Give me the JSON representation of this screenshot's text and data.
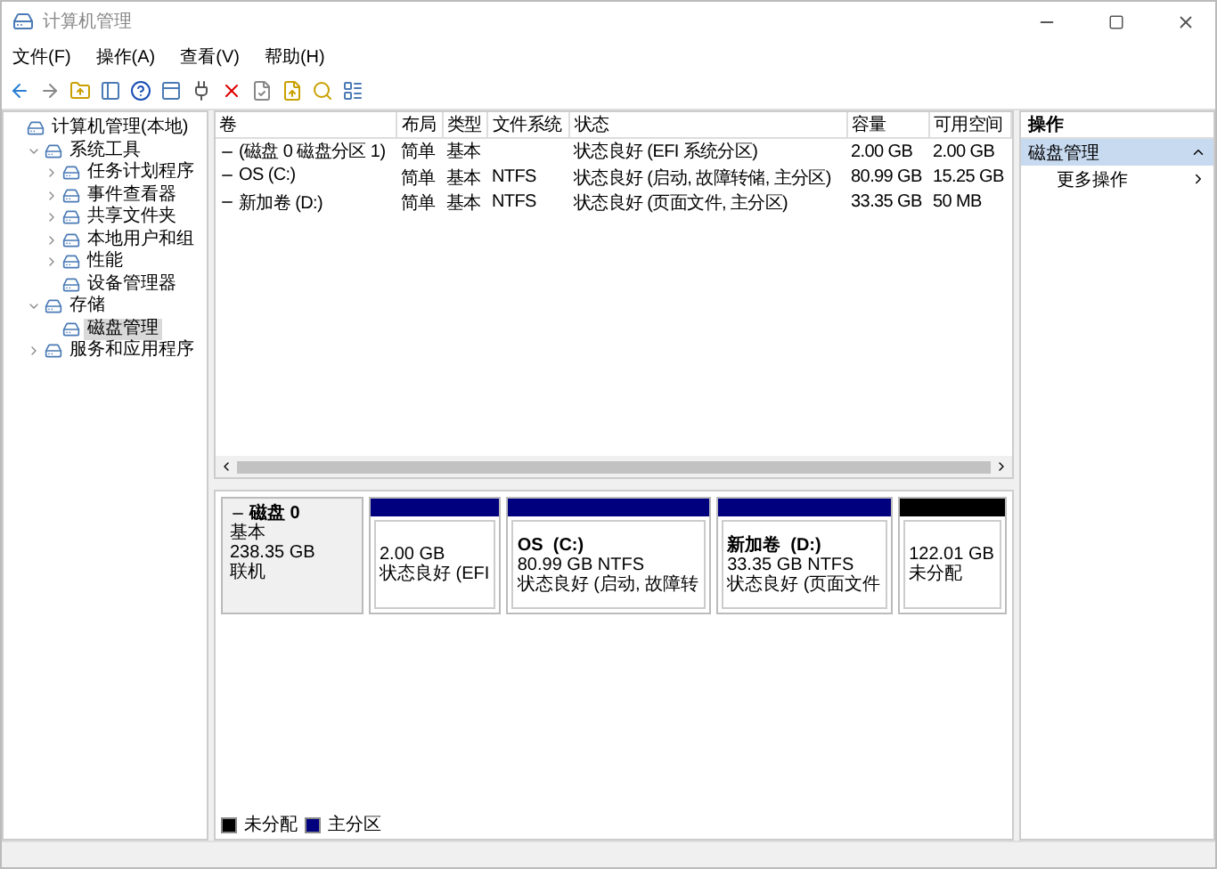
{
  "window": {
    "title": "计算机管理"
  },
  "menu": [
    "文件(F)",
    "操作(A)",
    "查看(V)",
    "帮助(H)"
  ],
  "tree": [
    {
      "label": "计算机管理(本地)",
      "selected": false,
      "children": [
        {
          "label": "系统工具",
          "expanded": true,
          "selected": false,
          "children": [
            {
              "label": "任务计划程序",
              "expanded": false,
              "selected": false
            },
            {
              "label": "事件查看器",
              "expanded": false,
              "selected": false
            },
            {
              "label": "共享文件夹",
              "expanded": false,
              "selected": false
            },
            {
              "label": "本地用户和组",
              "expanded": false,
              "selected": false
            },
            {
              "label": "性能",
              "expanded": false,
              "selected": false
            },
            {
              "label": "设备管理器",
              "selected": false
            }
          ]
        },
        {
          "label": "存储",
          "expanded": true,
          "selected": false,
          "children": [
            {
              "label": "磁盘管理",
              "selected": true
            }
          ]
        },
        {
          "label": "服务和应用程序",
          "expanded": false,
          "selected": false
        }
      ]
    }
  ],
  "volume_table": {
    "columns": [
      "卷",
      "布局",
      "类型",
      "文件系统",
      "状态",
      "容量",
      "可用空间"
    ],
    "rows": [
      [
        "(磁盘 0 磁盘分区 1)",
        "简单",
        "基本",
        "",
        "状态良好 (EFI 系统分区)",
        "2.00 GB",
        "2.00 GB"
      ],
      [
        "OS (C:)",
        "简单",
        "基本",
        "NTFS",
        "状态良好 (启动, 故障转储, 主分区)",
        "80.99 GB",
        "15.25 GB"
      ],
      [
        "新加卷 (D:)",
        "简单",
        "基本",
        "NTFS",
        "状态良好 (页面文件, 主分区)",
        "33.35 GB",
        "50 MB"
      ]
    ]
  },
  "disk": {
    "name": "磁盘 0",
    "type": "基本",
    "size": "238.35 GB",
    "status": "联机",
    "partitions": [
      {
        "size": "2.00 GB",
        "status": "状态良好 (EFI",
        "color": "#00007f"
      },
      {
        "name": "OS  (C:)",
        "size": "80.99 GB NTFS",
        "status": "状态良好 (启动, 故障转",
        "color": "#00007f"
      },
      {
        "name": "新加卷  (D:)",
        "size": "33.35 GB NTFS",
        "status": "状态良好 (页面文件",
        "color": "#00007f"
      },
      {
        "size": "122.01 GB",
        "status": "未分配",
        "color": "#000000"
      }
    ]
  },
  "legend": [
    {
      "label": "未分配",
      "color": "#000000"
    },
    {
      "label": "主分区",
      "color": "#00007f"
    }
  ],
  "actions": {
    "title": "操作",
    "section": "磁盘管理",
    "items": [
      "更多操作"
    ]
  }
}
